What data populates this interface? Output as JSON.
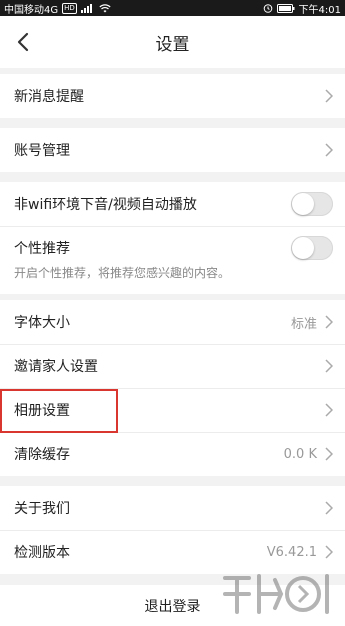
{
  "status_bar": {
    "carrier": "中国移动4G",
    "badge": "HD",
    "time": "下午4:01"
  },
  "header": {
    "title": "设置"
  },
  "groups": {
    "g1": {
      "items": [
        {
          "label": "新消息提醒"
        }
      ]
    },
    "g2": {
      "items": [
        {
          "label": "账号管理"
        }
      ]
    },
    "g3": {
      "items": [
        {
          "label": "非wifi环境下音/视频自动播放",
          "toggle": "off"
        },
        {
          "label": "个性推荐",
          "sub": "开启个性推荐，将推荐您感兴趣的内容。",
          "toggle": "off"
        }
      ]
    },
    "g4": {
      "items": [
        {
          "label": "字体大小",
          "value": "标准"
        },
        {
          "label": "邀请家人设置"
        },
        {
          "label": "相册设置"
        },
        {
          "label": "清除缓存",
          "value": "0.0 K"
        }
      ]
    },
    "g5": {
      "items": [
        {
          "label": "关于我们"
        },
        {
          "label": "检测版本",
          "value": "V6.42.1"
        }
      ]
    }
  },
  "logout_label": "退出登录",
  "colors": {
    "highlight": "#d9362f",
    "background": "#f2f2f2"
  }
}
